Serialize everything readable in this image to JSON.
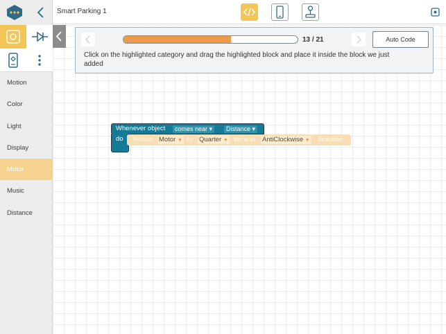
{
  "app": {
    "title": "Smart Parking 1"
  },
  "sidebar": {
    "categories": [
      {
        "label": "Motion",
        "active": false
      },
      {
        "label": "Color",
        "active": false
      },
      {
        "label": "Light",
        "active": false
      },
      {
        "label": "Display",
        "active": false
      },
      {
        "label": "Motor",
        "active": true
      },
      {
        "label": "Music",
        "active": false
      },
      {
        "label": "Distance",
        "active": false
      }
    ]
  },
  "tutorial": {
    "progress_fraction": 0.619,
    "counter": "13 / 21",
    "auto_code_label": "Auto Code",
    "instruction": "Click on the highlighted category and drag the highlighted block and place it inside the block we just added"
  },
  "blocks": {
    "event": {
      "prefix": "Whenever object",
      "condition": "comes near",
      "sensor": "Distance",
      "do": "do"
    },
    "action": {
      "word1": "Rotate",
      "motor": "Motor",
      "word2": "by",
      "amount": "Quarter",
      "word3": "turns in",
      "direction": "AntiClockwise",
      "word4": "direction"
    }
  },
  "colors": {
    "accent": "#f3c556",
    "progress": "#ee9949",
    "event_block": "#157a95",
    "motor_block_highlight": "#f9ddb4",
    "category_active": "#f5d38e"
  },
  "icons": {
    "logo": "robot-face-icon",
    "back": "chevron-left-icon",
    "mode_block": "block-mode-icon",
    "mode_flow": "flowchart-icon",
    "device": "device-icon",
    "more": "more-vertical-icon",
    "code": "code-icon",
    "phone": "phone-icon",
    "joystick": "joystick-icon",
    "menu": "menu-square-icon"
  }
}
